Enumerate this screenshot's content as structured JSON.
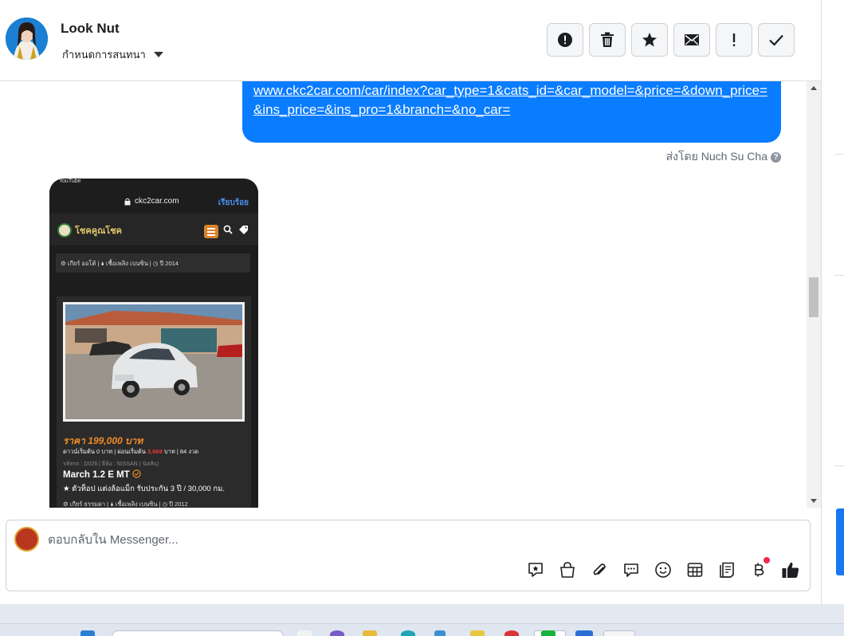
{
  "header": {
    "contact_name": "Look Nut",
    "subtitle": "กำหนดการสนทนา",
    "actions": [
      {
        "name": "report-button",
        "icon": "alert-circle-icon"
      },
      {
        "name": "delete-button",
        "icon": "trash-icon"
      },
      {
        "name": "star-button",
        "icon": "star-icon"
      },
      {
        "name": "mark-unread-button",
        "icon": "envelope-icon"
      },
      {
        "name": "spam-button",
        "icon": "exclamation-icon"
      },
      {
        "name": "done-button",
        "icon": "check-icon"
      }
    ]
  },
  "conversation": {
    "message_link": "www.ckc2car.com/car/index?car_type=1&cats_id=&car_model=&price=&down_price=&ins_price=&ins_pro=1&branch=&no_car=",
    "sent_by": "ส่งโดย Nuch Su Cha",
    "shared_image": {
      "app_label": "YouTube",
      "url": "ckc2car.com",
      "done_label": "เรียบร้อย",
      "site_logo": "โชคคูณโชค",
      "spec_row_1": "⚙ เกียร์ ออโต้  |  🌢 เชื้อเพลิง เบนซิน  |  ◷ ปี 2014",
      "price": "ราคา 199,000 บาท",
      "down_prefix": "ดาวน์เริ่มต้น 0 บาท | ผ่อนเริ่มต้น",
      "monthly": "3,669",
      "down_suffix": "บาท | 84 งวด",
      "code": "รหัสรถ : D026 | ยี่ห้อ : NISSAN ( นิสสัน)",
      "model": "March 1.2 E MT",
      "description": "★ ตัวท็อป แต่งล้อแม็ก รับประกัน 3 ปี / 30,000 กม.",
      "spec_row_2": "⚙ เกียร์ ธรรมดา  |  🌢 เชื้อเพลิง เบนซิน  |  ◷ ปี 2012"
    }
  },
  "composer": {
    "placeholder": "ตอบกลับใน Messenger...",
    "tools": [
      "sticker-icon",
      "shop-bag-icon",
      "attachment-icon",
      "saved-reply-icon",
      "emoji-icon",
      "table-icon",
      "notes-icon",
      "baht-icon",
      "like-icon"
    ]
  },
  "colors": {
    "accent": "#0a7cff",
    "brand_blue": "#1877f2",
    "notification_dot": "#f02849"
  }
}
